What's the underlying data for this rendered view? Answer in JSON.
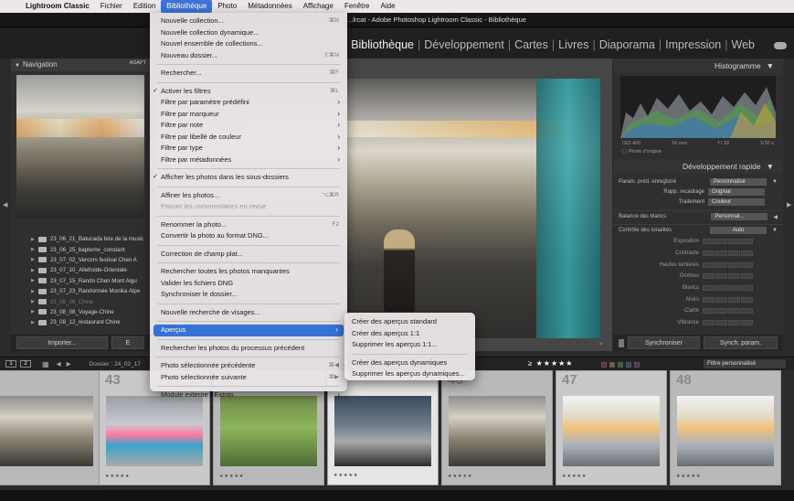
{
  "menubar": {
    "app": "Lightroom Classic",
    "items": [
      "Fichier",
      "Edition",
      "Bibliothèque",
      "Photo",
      "Métadonnées",
      "Affichage",
      "Fenêtre",
      "Aide"
    ],
    "active": "Bibliothèque"
  },
  "window": {
    "title": "...lrcat - Adobe Photoshop Lightroom Classic - Bibliothèque"
  },
  "modules": [
    "Bibliothèque",
    "Développement",
    "Cartes",
    "Livres",
    "Diaporama",
    "Impression",
    "Web"
  ],
  "active_module": "Bibliothèque",
  "left_panel": {
    "header": "Navigation",
    "header_right": "ADAPT",
    "folders": [
      {
        "name": "23_06_21_Batucada fete de la music",
        "dim": false
      },
      {
        "name": "23_06_25_bapteme_constant",
        "dim": false
      },
      {
        "name": "23_07_02_Vercors festival Chen A",
        "dim": false
      },
      {
        "name": "23_07_10_Allefroide-Orientale",
        "dim": false
      },
      {
        "name": "23_07_15_Rando Chen Mont Aigu",
        "dim": false
      },
      {
        "name": "23_07_23_Randonnée Monika Alpe",
        "dim": false
      },
      {
        "name": "23_08_06_Chine",
        "dim": true
      },
      {
        "name": "23_08_08_Voyage-Chine",
        "dim": false
      },
      {
        "name": "23_08_12_restaurant Chine",
        "dim": false
      }
    ],
    "import_btn": "Importer...",
    "export_btn": "E"
  },
  "right_panel": {
    "histogram_title": "Histogramme",
    "histo_info": [
      "ISO 400",
      "16 mm",
      "f / 18",
      "1/30 s"
    ],
    "original_label": "Photo d'origine",
    "quick_dev_title": "Développement rapide",
    "preset_label": "Param. préd. enregistré",
    "preset_value": "Personnalisé",
    "crop_label": "Rapp. recadrage",
    "crop_value": "Original",
    "treatment_label": "Traitement",
    "treatment_value": "Couleur",
    "wb_label": "Balance des blancs",
    "wb_value": "Personnal...",
    "tone_label": "Contrôle des tonalités",
    "auto_label": "Auto",
    "tone_rows": [
      "Exposition",
      "Contraste",
      "Hautes lumières",
      "Ombres",
      "Blancs",
      "Noirs",
      "Clarté",
      "Vibrance"
    ],
    "sync_btn": "Synchroniser",
    "sync_param_btn": "Synch. param."
  },
  "filmstrip_bar": {
    "page1": "1",
    "page2": "2",
    "folder_text": "Dossier : 24_02_17",
    "filter_label": "Filtre personnalisé"
  },
  "filmstrip": [
    {
      "num": "",
      "style": "thumb-train",
      "rating": ""
    },
    {
      "num": "43",
      "style": "thumb-pink",
      "rating": "★★★★★"
    },
    {
      "num": "",
      "style": "thumb-bike",
      "rating": "★★★★★"
    },
    {
      "num": "",
      "style": "thumb-dark",
      "rating": "★★★★★"
    },
    {
      "num": "46",
      "style": "thumb-train",
      "rating": "★★★★★"
    },
    {
      "num": "47",
      "style": "thumb-light",
      "rating": "★★★★★"
    },
    {
      "num": "48",
      "style": "thumb-light",
      "rating": "★★★★★"
    }
  ],
  "menu": {
    "groups": [
      [
        {
          "label": "Nouvelle collection...",
          "shortcut": "⌘N"
        },
        {
          "label": "Nouvelle collection dynamique..."
        },
        {
          "label": "Nouvel ensemble de collections..."
        },
        {
          "label": "Nouveau dossier...",
          "shortcut": "⇧⌘N"
        }
      ],
      [
        {
          "label": "Rechercher...",
          "shortcut": "⌘F"
        }
      ],
      [
        {
          "label": "Activer les filtres",
          "shortcut": "⌘L",
          "checked": true
        },
        {
          "label": "Filtre par paramètre prédéfini",
          "submenu": true
        },
        {
          "label": "Filtre par marqueur",
          "submenu": true
        },
        {
          "label": "Filtre par note",
          "submenu": true
        },
        {
          "label": "Filtre par libellé de couleur",
          "submenu": true
        },
        {
          "label": "Filtre par type",
          "submenu": true
        },
        {
          "label": "Filtre par métadonnées",
          "submenu": true
        }
      ],
      [
        {
          "label": "Afficher les photos dans les sous-dossiers",
          "checked": true
        }
      ],
      [
        {
          "label": "Affiner les photos...",
          "shortcut": "⌥⌘R"
        },
        {
          "label": "Passer les commentaires en revue",
          "disabled": true
        }
      ],
      [
        {
          "label": "Renommer la photo...",
          "shortcut": "F2"
        },
        {
          "label": "Convertir la photo au format DNG..."
        }
      ],
      [
        {
          "label": "Correction de champ plat..."
        }
      ],
      [
        {
          "label": "Rechercher toutes les photos manquantes"
        },
        {
          "label": "Valider les fichiers DNG"
        },
        {
          "label": "Synchroniser le dossier..."
        }
      ],
      [
        {
          "label": "Nouvelle recherche de visages..."
        }
      ],
      [
        {
          "label": "Aperçus",
          "submenu": true,
          "highlighted": true
        }
      ],
      [
        {
          "label": "Rechercher les photos du processus précédent"
        }
      ],
      [
        {
          "label": "Photo sélectionnée précédente",
          "shortcut": "⌘◀"
        },
        {
          "label": "Photo sélectionnée suivante",
          "shortcut": "⌘▶"
        }
      ],
      [
        {
          "label": "Module externe - Extras",
          "submenu": true
        }
      ]
    ]
  },
  "submenu": {
    "groups": [
      [
        {
          "label": "Créer des aperçus standard"
        },
        {
          "label": "Créer des aperçus 1:1"
        },
        {
          "label": "Supprimer les aperçus 1:1..."
        }
      ],
      [
        {
          "label": "Créer des aperçus dynamiques"
        },
        {
          "label": "Supprimer les aperçus dynamiques..."
        }
      ]
    ]
  }
}
